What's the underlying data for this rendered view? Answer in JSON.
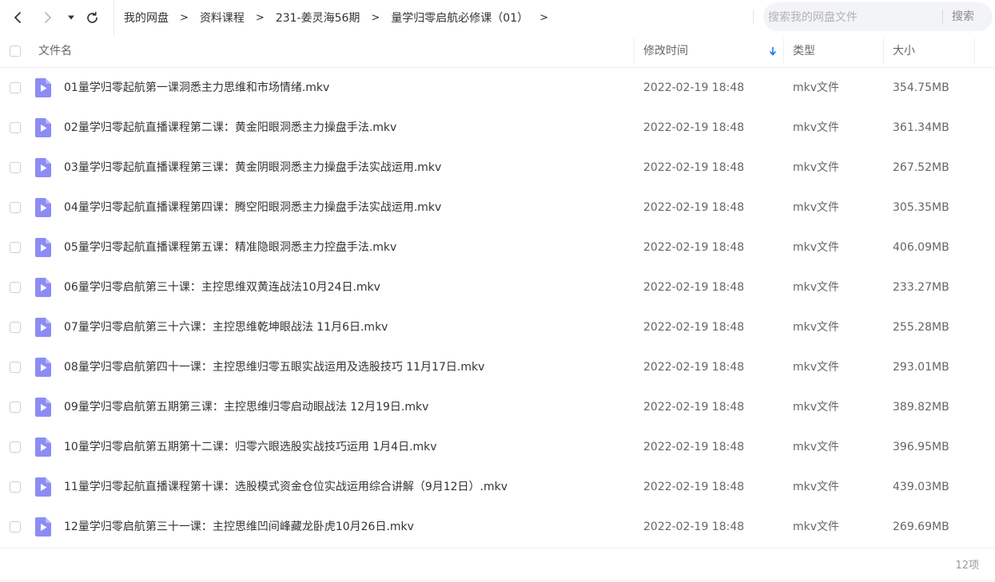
{
  "toolbar": {
    "back_icon": "chevron-left-icon",
    "forward_icon": "chevron-right-icon",
    "dropdown_icon": "caret-down-icon",
    "refresh_icon": "refresh-icon"
  },
  "breadcrumb": {
    "items": [
      "我的网盘",
      "资料课程",
      "231-姜灵海56期",
      "量学归零启航必修课（01）"
    ],
    "separator": ">"
  },
  "search": {
    "placeholder": "搜索我的网盘文件",
    "button_label": "搜索"
  },
  "table": {
    "columns": {
      "name": "文件名",
      "modified": "修改时间",
      "type": "类型",
      "size": "大小"
    },
    "sort_icon": "arrow-down-icon",
    "accent_color": "#1a73e8",
    "file_icon_color": "#8c8cf5",
    "rows": [
      {
        "name": "01量学归零起航第一课洞悉主力思维和市场情绪.mkv",
        "modified": "2022-02-19 18:48",
        "type": "mkv文件",
        "size": "354.75MB"
      },
      {
        "name": "02量学归零起航直播课程第二课：黄金阳眼洞悉主力操盘手法.mkv",
        "modified": "2022-02-19 18:48",
        "type": "mkv文件",
        "size": "361.34MB"
      },
      {
        "name": "03量学归零起航直播课程第三课：黄金阴眼洞悉主力操盘手法实战运用.mkv",
        "modified": "2022-02-19 18:48",
        "type": "mkv文件",
        "size": "267.52MB"
      },
      {
        "name": "04量学归零起航直播课程第四课：腾空阳眼洞悉主力操盘手法实战运用.mkv",
        "modified": "2022-02-19 18:48",
        "type": "mkv文件",
        "size": "305.35MB"
      },
      {
        "name": "05量学归零起航直播课程第五课：精准隐眼洞悉主力控盘手法.mkv",
        "modified": "2022-02-19 18:48",
        "type": "mkv文件",
        "size": "406.09MB"
      },
      {
        "name": "06量学归零启航第三十课：主控思维双黄连战法10月24日.mkv",
        "modified": "2022-02-19 18:48",
        "type": "mkv文件",
        "size": "233.27MB"
      },
      {
        "name": "07量学归零启航第三十六课：主控思维乾坤眼战法 11月6日.mkv",
        "modified": "2022-02-19 18:48",
        "type": "mkv文件",
        "size": "255.28MB"
      },
      {
        "name": "08量学归零启航第四十一课：主控思维归零五眼实战运用及选股技巧 11月17日.mkv",
        "modified": "2022-02-19 18:48",
        "type": "mkv文件",
        "size": "293.01MB"
      },
      {
        "name": "09量学归零启航第五期第三课：主控思维归零启动眼战法 12月19日.mkv",
        "modified": "2022-02-19 18:48",
        "type": "mkv文件",
        "size": "389.82MB"
      },
      {
        "name": "10量学归零启航第五期第十二课：归零六眼选股实战技巧运用 1月4日.mkv",
        "modified": "2022-02-19 18:48",
        "type": "mkv文件",
        "size": "396.95MB"
      },
      {
        "name": "11量学归零起航直播课程第十课：选股模式资金仓位实战运用综合讲解（9月12日）.mkv",
        "modified": "2022-02-19 18:48",
        "type": "mkv文件",
        "size": "439.03MB"
      },
      {
        "name": "12量学归零启航第三十一课：主控思维凹间峰藏龙卧虎10月26日.mkv",
        "modified": "2022-02-19 18:48",
        "type": "mkv文件",
        "size": "269.69MB"
      }
    ]
  },
  "footer": {
    "count_label": "12项"
  }
}
